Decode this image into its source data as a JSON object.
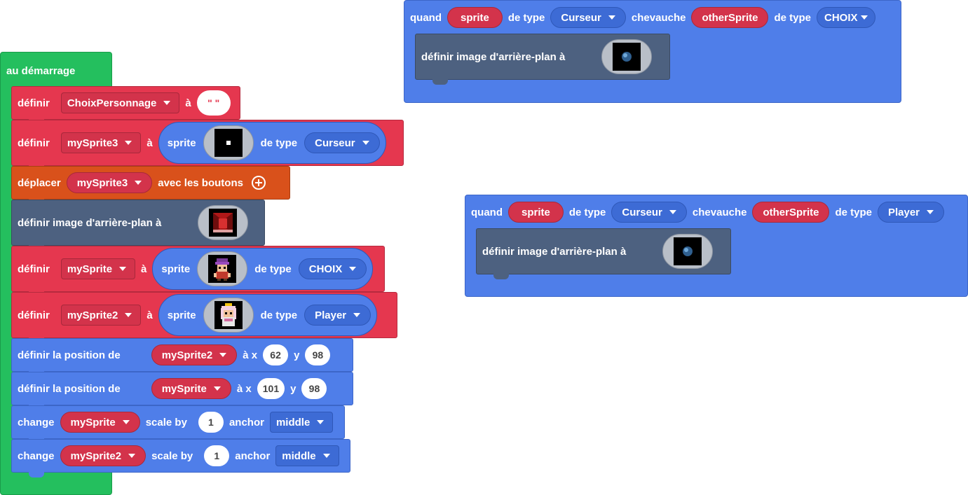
{
  "start_block": {
    "label": "au démarrage",
    "blocks": [
      {
        "kind": "set",
        "label": "définir",
        "variable": "ChoixPersonnage",
        "to": "à",
        "value": "\" \""
      },
      {
        "kind": "set_sprite",
        "label": "définir",
        "variable": "mySprite3",
        "to": "à",
        "sprite_label": "sprite",
        "type_label": "de type",
        "type_value": "Curseur",
        "image": "cursor-sprite"
      },
      {
        "kind": "move",
        "label": "déplacer",
        "variable": "mySprite3",
        "suffix": "avec les boutons",
        "icon": "add-circle-icon"
      },
      {
        "kind": "background",
        "label": "définir image d'arrière-plan à",
        "image": "stage-background"
      },
      {
        "kind": "set_sprite",
        "label": "définir",
        "variable": "mySprite",
        "to": "à",
        "sprite_label": "sprite",
        "type_label": "de type",
        "type_value": "CHOIX",
        "image": "character-purple"
      },
      {
        "kind": "set_sprite",
        "label": "définir",
        "variable": "mySprite2",
        "to": "à",
        "sprite_label": "sprite",
        "type_label": "de type",
        "type_value": "Player",
        "image": "character-princess"
      },
      {
        "kind": "position",
        "label": "définir la position de",
        "variable": "mySprite2",
        "x_label": "à x",
        "x": "62",
        "y_label": "y",
        "y": "98"
      },
      {
        "kind": "position",
        "label": "définir la position de",
        "variable": "mySprite",
        "x_label": "à x",
        "x": "101",
        "y_label": "y",
        "y": "98"
      },
      {
        "kind": "scale",
        "label": "change",
        "variable": "mySprite",
        "scale_label": "scale by",
        "scale": "1",
        "anchor_label": "anchor",
        "anchor": "middle"
      },
      {
        "kind": "scale",
        "label": "change",
        "variable": "mySprite2",
        "scale_label": "scale by",
        "scale": "1",
        "anchor_label": "anchor",
        "anchor": "middle"
      }
    ]
  },
  "overlap_events": [
    {
      "when_label": "quand",
      "sprite": "sprite",
      "type_label": "de type",
      "type_a": "Curseur",
      "overlap_label": "chevauche",
      "other": "otherSprite",
      "type_label2": "de type",
      "type_b": "CHOIX",
      "inner_label": "définir image d'arrière-plan à",
      "image": "planet-background"
    },
    {
      "when_label": "quand",
      "sprite": "sprite",
      "type_label": "de type",
      "type_a": "Curseur",
      "overlap_label": "chevauche",
      "other": "otherSprite",
      "type_label2": "de type",
      "type_b": "Player",
      "inner_label": "définir image d'arrière-plan à",
      "image": "planet-background"
    }
  ],
  "colors": {
    "events_green": "#24bf5e",
    "variables_red": "#e5374f",
    "controller_orange": "#d9511b",
    "scene_slate": "#4d6180",
    "sprites_blue": "#4f7ee9"
  }
}
